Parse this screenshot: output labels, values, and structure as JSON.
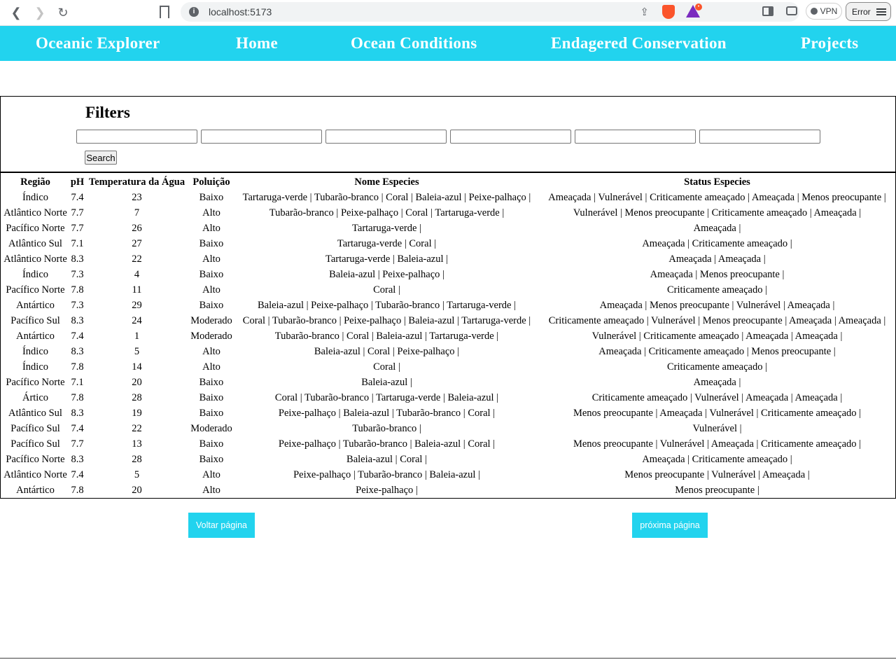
{
  "browser": {
    "url": "localhost:5173",
    "vpn_label": "VPN",
    "error_label": "Error",
    "rewards_badge": "•"
  },
  "navbar": {
    "brand": "Oceanic Explorer",
    "links": [
      "Home",
      "Ocean Conditions",
      "Endagered Conservation",
      "Projects"
    ]
  },
  "filters": {
    "title": "Filters",
    "inputs": [
      "",
      "",
      "",
      "",
      "",
      ""
    ],
    "search_label": "Search"
  },
  "table": {
    "headers": [
      "Região",
      "pH",
      "Temperatura da Água",
      "Poluição",
      "Nome Especies",
      "Status Especies"
    ],
    "rows": [
      [
        "Índico",
        "7.4",
        "23",
        "Baixo",
        "Tartaruga-verde | Tubarão-branco | Coral | Baleia-azul | Peixe-palhaço |",
        "Ameaçada | Vulnerável | Criticamente ameaçado | Ameaçada | Menos preocupante |"
      ],
      [
        "Atlântico Norte",
        "7.7",
        "7",
        "Alto",
        "Tubarão-branco | Peixe-palhaço | Coral | Tartaruga-verde |",
        "Vulnerável | Menos preocupante | Criticamente ameaçado | Ameaçada |"
      ],
      [
        "Pacífico Norte",
        "7.7",
        "26",
        "Alto",
        "Tartaruga-verde |",
        "Ameaçada |"
      ],
      [
        "Atlântico Sul",
        "7.1",
        "27",
        "Baixo",
        "Tartaruga-verde | Coral |",
        "Ameaçada | Criticamente ameaçado |"
      ],
      [
        "Atlântico Norte",
        "8.3",
        "22",
        "Alto",
        "Tartaruga-verde | Baleia-azul |",
        "Ameaçada | Ameaçada |"
      ],
      [
        "Índico",
        "7.3",
        "4",
        "Baixo",
        "Baleia-azul | Peixe-palhaço |",
        "Ameaçada | Menos preocupante |"
      ],
      [
        "Pacífico Norte",
        "7.8",
        "11",
        "Alto",
        "Coral |",
        "Criticamente ameaçado |"
      ],
      [
        "Antártico",
        "7.3",
        "29",
        "Baixo",
        "Baleia-azul | Peixe-palhaço | Tubarão-branco | Tartaruga-verde |",
        "Ameaçada | Menos preocupante | Vulnerável | Ameaçada |"
      ],
      [
        "Pacífico Sul",
        "8.3",
        "24",
        "Moderado",
        "Coral | Tubarão-branco | Peixe-palhaço | Baleia-azul | Tartaruga-verde |",
        "Criticamente ameaçado | Vulnerável | Menos preocupante | Ameaçada | Ameaçada |"
      ],
      [
        "Antártico",
        "7.4",
        "1",
        "Moderado",
        "Tubarão-branco | Coral | Baleia-azul | Tartaruga-verde |",
        "Vulnerável | Criticamente ameaçado | Ameaçada | Ameaçada |"
      ],
      [
        "Índico",
        "8.3",
        "5",
        "Alto",
        "Baleia-azul | Coral | Peixe-palhaço |",
        "Ameaçada | Criticamente ameaçado | Menos preocupante |"
      ],
      [
        "Índico",
        "7.8",
        "14",
        "Alto",
        "Coral |",
        "Criticamente ameaçado |"
      ],
      [
        "Pacífico Norte",
        "7.1",
        "20",
        "Baixo",
        "Baleia-azul |",
        "Ameaçada |"
      ],
      [
        "Ártico",
        "7.8",
        "28",
        "Baixo",
        "Coral | Tubarão-branco | Tartaruga-verde | Baleia-azul |",
        "Criticamente ameaçado | Vulnerável | Ameaçada | Ameaçada |"
      ],
      [
        "Atlântico Sul",
        "8.3",
        "19",
        "Baixo",
        "Peixe-palhaço | Baleia-azul | Tubarão-branco | Coral |",
        "Menos preocupante | Ameaçada | Vulnerável | Criticamente ameaçado |"
      ],
      [
        "Pacífico Sul",
        "7.4",
        "22",
        "Moderado",
        "Tubarão-branco |",
        "Vulnerável |"
      ],
      [
        "Pacífico Sul",
        "7.7",
        "13",
        "Baixo",
        "Peixe-palhaço | Tubarão-branco | Baleia-azul | Coral |",
        "Menos preocupante | Vulnerável | Ameaçada | Criticamente ameaçado |"
      ],
      [
        "Pacífico Norte",
        "8.3",
        "28",
        "Baixo",
        "Baleia-azul | Coral |",
        "Ameaçada | Criticamente ameaçado |"
      ],
      [
        "Atlântico Norte",
        "7.4",
        "5",
        "Alto",
        "Peixe-palhaço | Tubarão-branco | Baleia-azul |",
        "Menos preocupante | Vulnerável | Ameaçada |"
      ],
      [
        "Antártico",
        "7.8",
        "20",
        "Alto",
        "Peixe-palhaço |",
        "Menos preocupante |"
      ]
    ]
  },
  "pagination": {
    "prev_label": "Voltar página",
    "next_label": "próxima página"
  },
  "colors": {
    "accent": "#22d3ee"
  }
}
